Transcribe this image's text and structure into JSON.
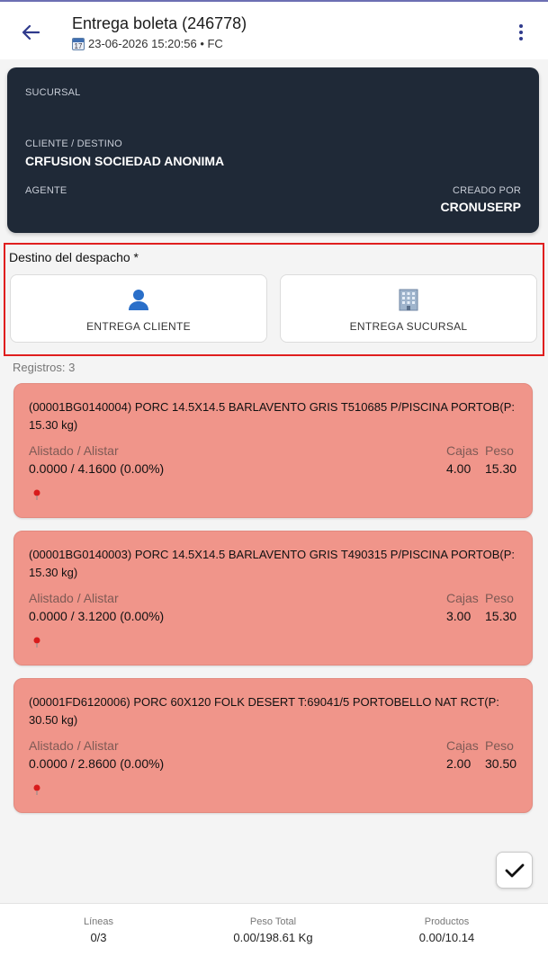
{
  "header": {
    "title": "Entrega boleta (246778)",
    "subtitle": "23-06-2026 15:20:56 • FC",
    "calendar_day": "17"
  },
  "summary": {
    "sucursal_label": "SUCURSAL",
    "cliente_label": "CLIENTE / DESTINO",
    "cliente_value": "CRFUSION SOCIEDAD ANONIMA",
    "agente_label": "AGENTE",
    "creado_label": "CREADO POR",
    "creado_value": "CRONUSERP"
  },
  "destino": {
    "label": "Destino del despacho *",
    "options": [
      {
        "label": "ENTREGA CLIENTE",
        "icon": "person-icon"
      },
      {
        "label": "ENTREGA SUCURSAL",
        "icon": "building-icon"
      }
    ]
  },
  "registros": "Registros: 3",
  "item_labels": {
    "alistado": "Alistado / Alistar",
    "cajas": "Cajas",
    "peso": "Peso"
  },
  "items": [
    {
      "description": "(00001BG0140004) PORC 14.5X14.5 BARLAVENTO GRIS T510685 P/PISCINA PORTOB(P: 15.30 kg)",
      "alistado": "0.0000 / 4.1600 (0.00%)",
      "cajas": "4.00",
      "peso": "15.30"
    },
    {
      "description": "(00001BG0140003) PORC 14.5X14.5 BARLAVENTO GRIS T490315 P/PISCINA PORTOB(P: 15.30 kg)",
      "alistado": "0.0000 / 3.1200 (0.00%)",
      "cajas": "3.00",
      "peso": "15.30"
    },
    {
      "description": "(00001FD6120006) PORC 60X120 FOLK DESERT T:69041/5  PORTOBELLO NAT RCT(P: 30.50 kg)",
      "alistado": "0.0000 / 2.8600 (0.00%)",
      "cajas": "2.00",
      "peso": "30.50"
    }
  ],
  "footer": {
    "lineas_label": "Líneas",
    "lineas_value": "0/3",
    "peso_label": "Peso Total",
    "peso_value": "0.00/198.61 Kg",
    "productos_label": "Productos",
    "productos_value": "0.00/10.14"
  },
  "colors": {
    "accent": "#2f3a8c",
    "card_dark": "#1f2937",
    "item_bg": "#f0958a",
    "highlight_border": "#e01e1e"
  }
}
